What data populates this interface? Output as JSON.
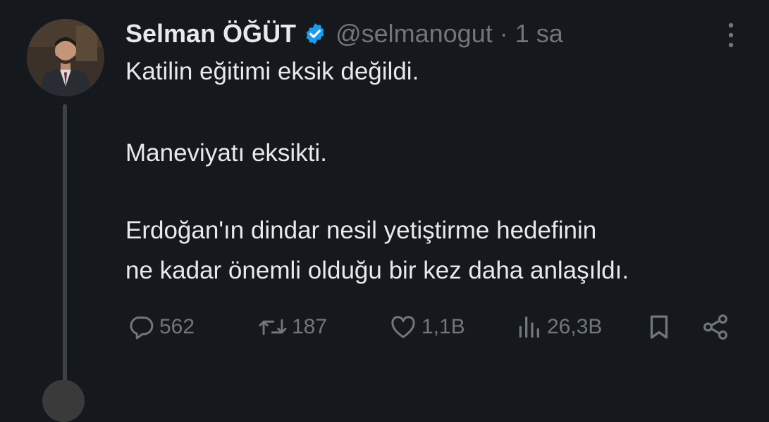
{
  "tweet": {
    "author_name": "Selman ÖĞÜT",
    "handle_time": "@selmanogut · 1 sa",
    "lines": [
      "Katilin eğitimi eksik değildi.",
      "Maneviyatı eksikti.",
      "Erdoğan'ın dindar nesil yetiştirme hedefinin",
      "ne kadar önemli olduğu bir kez daha anlaşıldı."
    ],
    "stats": {
      "replies": "562",
      "retweets": "187",
      "likes": "1,1B",
      "views": "26,3B"
    }
  },
  "next_reply": {
    "author_preview": ""
  },
  "icons": {
    "verified": "verified-badge-icon",
    "more": "more-vertical-icon",
    "reply": "reply-bubble-icon",
    "retweet": "retweet-icon",
    "like": "heart-icon",
    "views": "bar-chart-icon",
    "bookmark": "bookmark-icon",
    "share": "share-icon"
  },
  "colors": {
    "background": "#15181c",
    "text": "#e7e9ea",
    "muted": "#71767b",
    "verified": "#1d9bf0"
  }
}
